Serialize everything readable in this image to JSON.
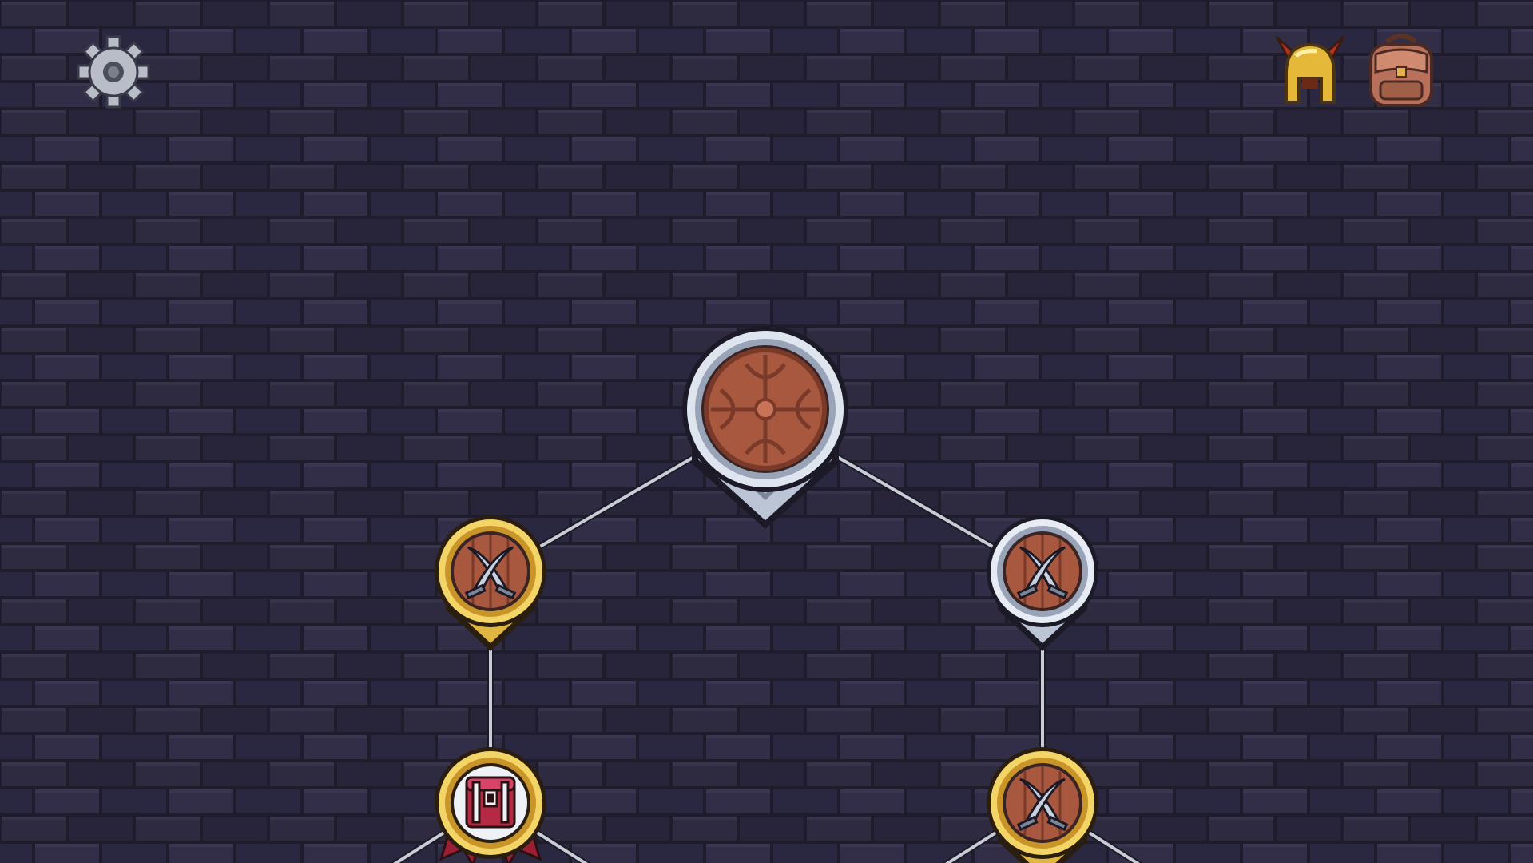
{
  "hud": {
    "settings_icon": "gear-icon",
    "character_icon": "horned-helmet-icon",
    "inventory_icon": "backpack-icon"
  },
  "skill_tree": {
    "nodes": [
      {
        "id": "root",
        "icon": "wooden-shield-icon",
        "frame": "silver",
        "size": "large"
      },
      {
        "id": "left-1",
        "icon": "crossed-swords-icon",
        "frame": "gold",
        "size": "small"
      },
      {
        "id": "right-1",
        "icon": "crossed-swords-icon",
        "frame": "silver",
        "size": "small"
      },
      {
        "id": "left-2",
        "icon": "treasure-chest-icon",
        "frame": "gold-ribbon",
        "size": "small"
      },
      {
        "id": "right-2",
        "icon": "crossed-swords-icon",
        "frame": "gold",
        "size": "small"
      }
    ],
    "connections": [
      [
        "root",
        "left-1"
      ],
      [
        "root",
        "right-1"
      ],
      [
        "left-1",
        "left-2"
      ],
      [
        "right-1",
        "right-2"
      ]
    ]
  },
  "colors": {
    "wall_dark": "#23202f",
    "wall_brick": "#2e2b40",
    "wall_brick_light": "#37334c",
    "wood": "#a7583f",
    "gold": "#e1b640",
    "silver": "#cfd6e4",
    "link": "#c7ccd6"
  }
}
